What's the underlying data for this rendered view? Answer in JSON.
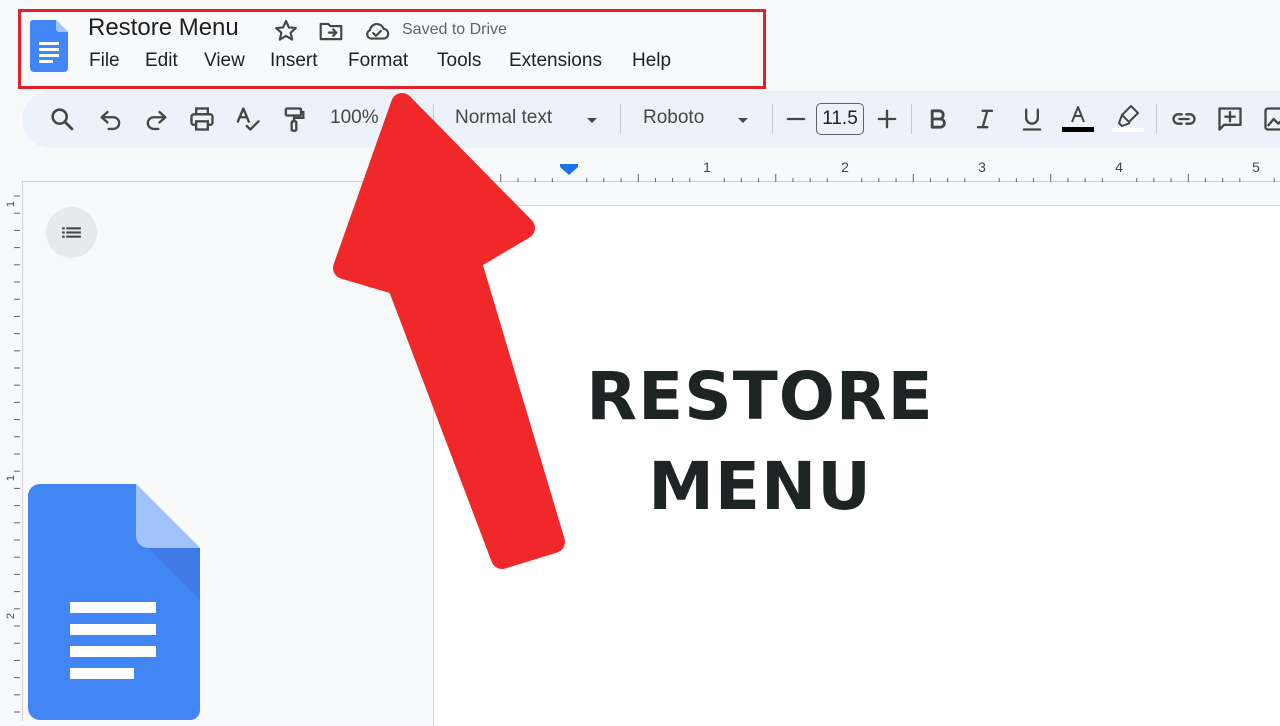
{
  "document": {
    "title": "Restore Menu",
    "save_status": "Saved to Drive"
  },
  "menu": {
    "items": [
      "File",
      "Edit",
      "View",
      "Insert",
      "Format",
      "Tools",
      "Extensions",
      "Help"
    ]
  },
  "toolbar": {
    "zoom": "100%",
    "paragraph_style": "Normal text",
    "font_family": "Roboto",
    "font_size": "11.5",
    "icons": [
      "search-icon",
      "undo-icon",
      "redo-icon",
      "print-icon",
      "spellcheck-icon",
      "paint-format-icon",
      "bold-icon",
      "italic-icon",
      "underline-icon",
      "text-color-icon",
      "highlight-icon",
      "link-icon",
      "add-comment-icon",
      "insert-image-icon"
    ]
  },
  "ruler": {
    "labels": [
      "1",
      "2",
      "3",
      "4",
      "5"
    ],
    "vertical_labels": [
      "1",
      "1",
      "2"
    ]
  },
  "page": {
    "heading_line1": "RESTORE",
    "heading_line2": "MENU"
  },
  "colors": {
    "accent_red": "#e4202a",
    "arrow_red": "#f1282a",
    "docs_blue": "#4285f4",
    "toolbar_bg": "#edf2fa"
  }
}
